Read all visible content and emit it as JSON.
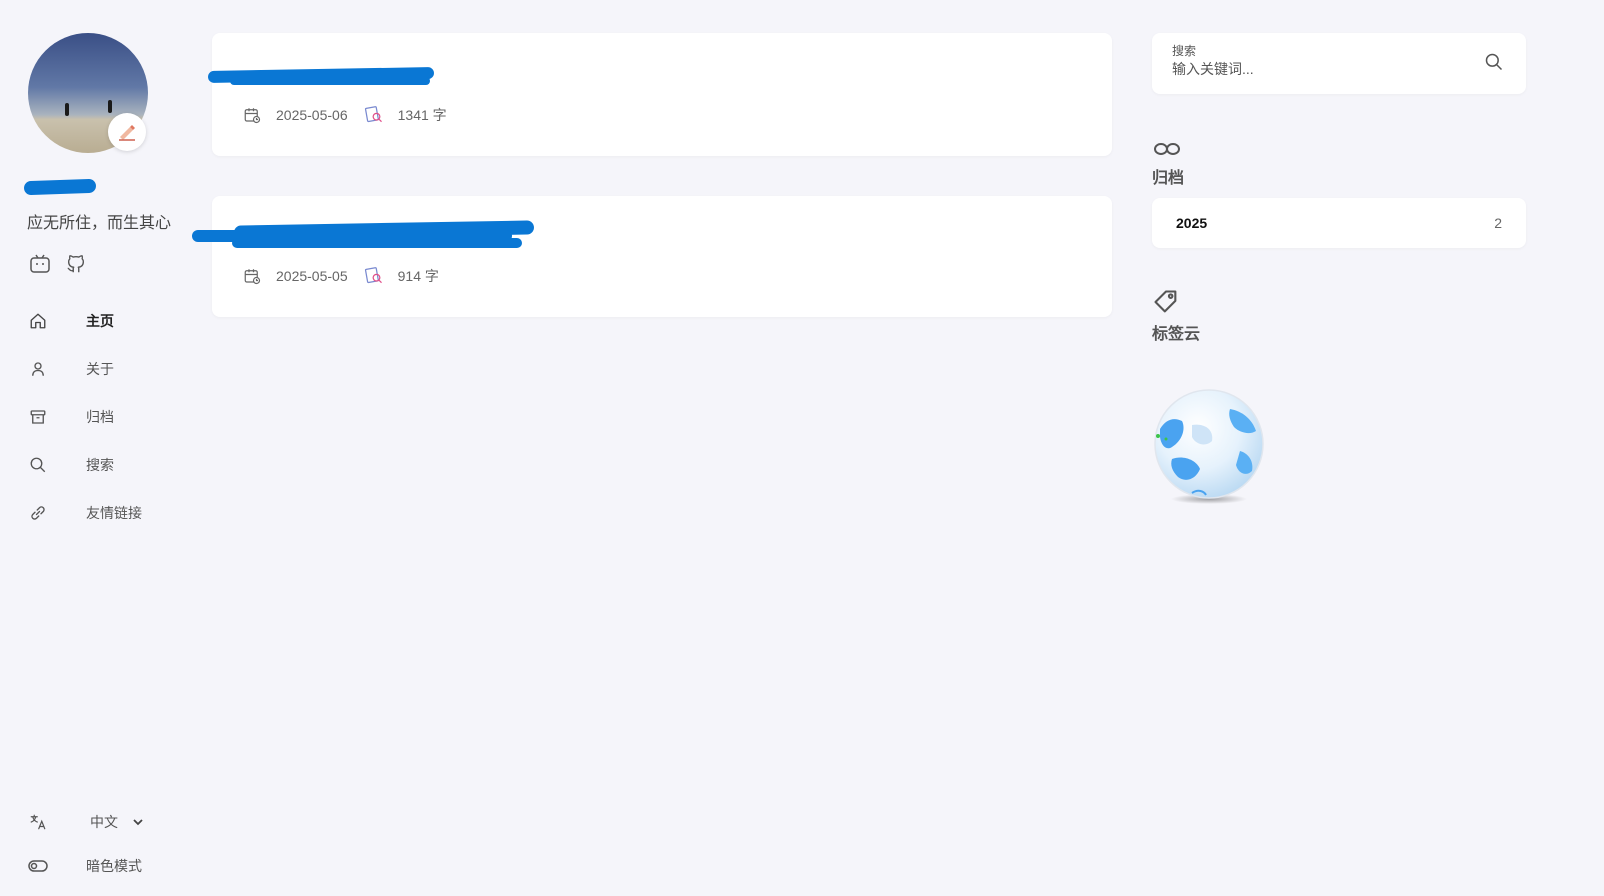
{
  "sidebar": {
    "site_name": "",
    "motto": "应无所住，而生其心",
    "menu": [
      {
        "label": "主页",
        "icon": "home-icon",
        "active": true
      },
      {
        "label": "关于",
        "icon": "user-icon",
        "active": false
      },
      {
        "label": "归档",
        "icon": "archive-icon",
        "active": false
      },
      {
        "label": "搜索",
        "icon": "search-icon",
        "active": false
      },
      {
        "label": "友情链接",
        "icon": "link-icon",
        "active": false
      }
    ],
    "language": "中文",
    "dark_mode": "暗色模式"
  },
  "posts": [
    {
      "title": "",
      "date": "2025-05-06",
      "word_count": "1341 字"
    },
    {
      "title": "",
      "date": "2025-05-05",
      "word_count": "914 字"
    }
  ],
  "search": {
    "label": "搜索",
    "placeholder": "输入关键词..."
  },
  "archives": {
    "title": "归档",
    "items": [
      {
        "year": "2025",
        "count": "2"
      }
    ]
  },
  "tag_cloud": {
    "title": "标签云"
  },
  "colors": {
    "background": "#f5f5fa",
    "card": "#ffffff",
    "redaction": "#0a77d4",
    "globe": "#4aa3f0"
  }
}
